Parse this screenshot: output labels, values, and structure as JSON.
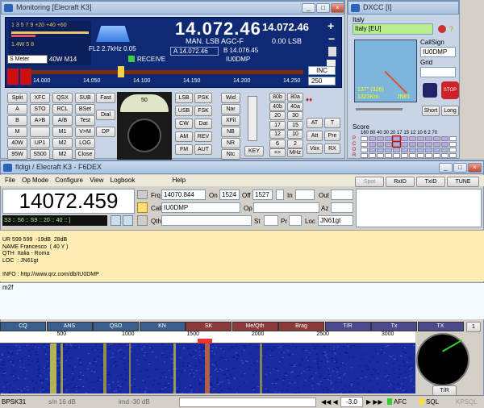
{
  "k3": {
    "title": "Monitoring [Elecraft K3]",
    "freq_main": "14.072.46",
    "freq_sub": "14.072.46",
    "mode_line": "MAN. LSB AGC-F",
    "sub_mode": "0.00 LSB",
    "filter": "FL2 2.7kHz 0.05",
    "vfo_a": "A 14.072.46",
    "vfo_b": "B 14.076.45",
    "callsign": "IU0DMP",
    "power": "40W M14",
    "receive": "RECEIVE",
    "meter_select": "S Meter",
    "smeter_scale_top": "1  3  5  7  9  +20  +40  +60",
    "smeter_scale_bottom": "1.4W 5  8",
    "band_ticks": [
      "14.000",
      "14.050",
      "14.100",
      "14.150",
      "14.200",
      "14.250"
    ],
    "inc": "INC",
    "step": "250",
    "left_buttons": [
      [
        "Split",
        "XFC",
        "QSX",
        "SUB"
      ],
      [
        "A",
        "STO",
        "RCL",
        "BSet"
      ],
      [
        "B",
        "A>B",
        "A/B",
        "Test"
      ],
      [
        "M",
        "",
        "M1",
        "V>M"
      ],
      [
        "40W",
        "UP1",
        "M2",
        "LOG"
      ],
      [
        "95W",
        "S500",
        "M2",
        "Close"
      ]
    ],
    "mid_buttons": [
      "Fast",
      "Dial",
      "DP"
    ],
    "dial_scale": "50",
    "mode_buttons": [
      [
        "LSB",
        "PSK"
      ],
      [
        "USB",
        "FSK"
      ],
      [
        "CW",
        "Dat"
      ],
      [
        "AM",
        "REV"
      ],
      [
        "FM",
        "AUT"
      ]
    ],
    "filter_buttons": [
      "Wid",
      "Nar",
      "XFil",
      "NB",
      "NR",
      "Ntc"
    ],
    "key_label": "KEY",
    "right_buttons": [
      [
        "80b",
        "80a"
      ],
      [
        "40b",
        "40a"
      ],
      [
        "20",
        "30"
      ],
      [
        "17",
        "15"
      ],
      [
        "12",
        "10"
      ],
      [
        "6",
        "2"
      ],
      [
        "=>",
        "MHz"
      ]
    ],
    "att_buttons": [
      [
        "AT",
        "T"
      ],
      [
        "Att",
        "Pre"
      ],
      [
        "Vox",
        "RX"
      ]
    ]
  },
  "dxcc": {
    "title": "DXCC [I]",
    "country": "Italy",
    "country_field": "Italy [EU]",
    "callsign_label": "CallSign",
    "callsign": "IU0DMP",
    "grid_label": "Grid",
    "grid": "",
    "bearing": "137° (326)",
    "distance": "1323Km",
    "locator": "JN61",
    "stop": "STOP",
    "short": "Short",
    "long": "Long",
    "score_label": "Score",
    "score_bands": "160 80 40 30 20 17 15 12 10  6  2  70",
    "score_rows": [
      "P",
      "C",
      "D",
      "R"
    ]
  },
  "fldigi": {
    "title": "fldigi / Elecraft K3 - F6DEX",
    "menu": [
      "File",
      "Op Mode",
      "Configure",
      "View",
      "Logbook",
      "Help"
    ],
    "top_buttons": [
      "Spot",
      "RxID",
      "TxID",
      "TUNE"
    ],
    "big_freq": "14072.459",
    "frq_label": "Frq",
    "frq": "14070.844",
    "on_label": "On",
    "on": "1524",
    "off_label": "Off",
    "off": "1527",
    "in_label": "In",
    "out_label": "Out",
    "call_label": "Call",
    "call": "IU0DMP",
    "op_label": "Op",
    "az_label": "Az",
    "qth_label": "Qth",
    "st_label": "St",
    "pr_label": "Pr",
    "loc_label": "Loc",
    "loc": "JN61gt",
    "smeter_text": "S3 :: S6 :: S9 :: 20 :: 40 :: ]",
    "rx_text": "UR 599 599  -19dB  28dB\nNAME Francesco  ( 40 Y )\nQTH  Italia - Roma\nLOC  : JN61gt\n\nINFO : http://www.qrz.com/db/IU0DMP",
    "tx_text": "m2f",
    "macros": [
      "CQ",
      "ANS",
      "QSO",
      "KN",
      "SK",
      "Me/Qth",
      "Brag",
      "T/R",
      "Tx",
      "TX"
    ],
    "macro_page": "1",
    "wf_ticks": [
      "500",
      "1000",
      "1500",
      "2000",
      "2500",
      "3000"
    ],
    "tr_button": "T/R",
    "mode": "BPSK31",
    "sn": "s/n  16 dB",
    "imd": "imd -30 dB",
    "offset": "-3.0",
    "afc": "AFC",
    "sql": "SQL",
    "kpsql": "KPSQL"
  },
  "colors": {
    "k3_panel": "#0f2a74",
    "freq_text": "#ffffff",
    "rx_bg": "#ffeeb3",
    "tx_bg": "#f4fbff",
    "waterfall": "#1a2aa0",
    "stop": "#d0202a"
  }
}
